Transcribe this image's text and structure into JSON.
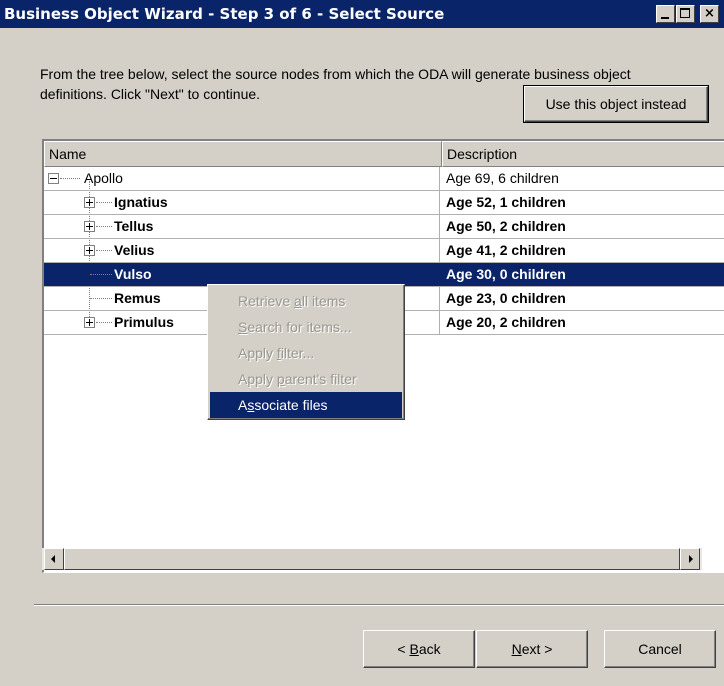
{
  "window": {
    "title": "Business Object Wizard - Step 3 of 6 - Select Source",
    "controls": {
      "minimize": "_",
      "maximize": "□",
      "close": "×"
    }
  },
  "instructions": "From the tree below, select the source nodes from which the ODA will generate business object definitions. Click \"Next\" to continue.",
  "use_object_button": "Use this object instead",
  "tree": {
    "columns": {
      "name": "Name",
      "description": "Description"
    },
    "rows": [
      {
        "name": "Apollo",
        "description": "Age 69, 6 children"
      },
      {
        "name": "Ignatius",
        "description": "Age 52, 1 children"
      },
      {
        "name": "Tellus",
        "description": "Age 50, 2 children"
      },
      {
        "name": "Velius",
        "description": "Age 41, 2 children"
      },
      {
        "name": "Vulso",
        "description": "Age 30, 0 children",
        "selected": true
      },
      {
        "name": "Remus",
        "description": "Age 23, 0 children"
      },
      {
        "name": "Primulus",
        "description": "Age 20, 2 children"
      }
    ]
  },
  "context_menu": {
    "items": [
      {
        "pre": "Retrieve ",
        "key": "a",
        "post": "ll items",
        "enabled": false
      },
      {
        "pre": "",
        "key": "S",
        "post": "earch for items...",
        "enabled": false
      },
      {
        "pre": "Apply ",
        "key": "f",
        "post": "ilter...",
        "enabled": false
      },
      {
        "pre": "Apply ",
        "key": "p",
        "post": "arent's filter",
        "enabled": false
      },
      {
        "pre": "A",
        "key": "s",
        "post": "sociate files",
        "enabled": true,
        "highlighted": true
      }
    ]
  },
  "footer": {
    "back": {
      "pre": "< ",
      "key": "B",
      "post": "ack"
    },
    "next": {
      "pre": "",
      "key": "N",
      "post": "ext >"
    },
    "cancel": "Cancel"
  },
  "colors": {
    "title_bar": "#0a246a",
    "selection": "#0a246a",
    "face": "#d4d0c8"
  }
}
